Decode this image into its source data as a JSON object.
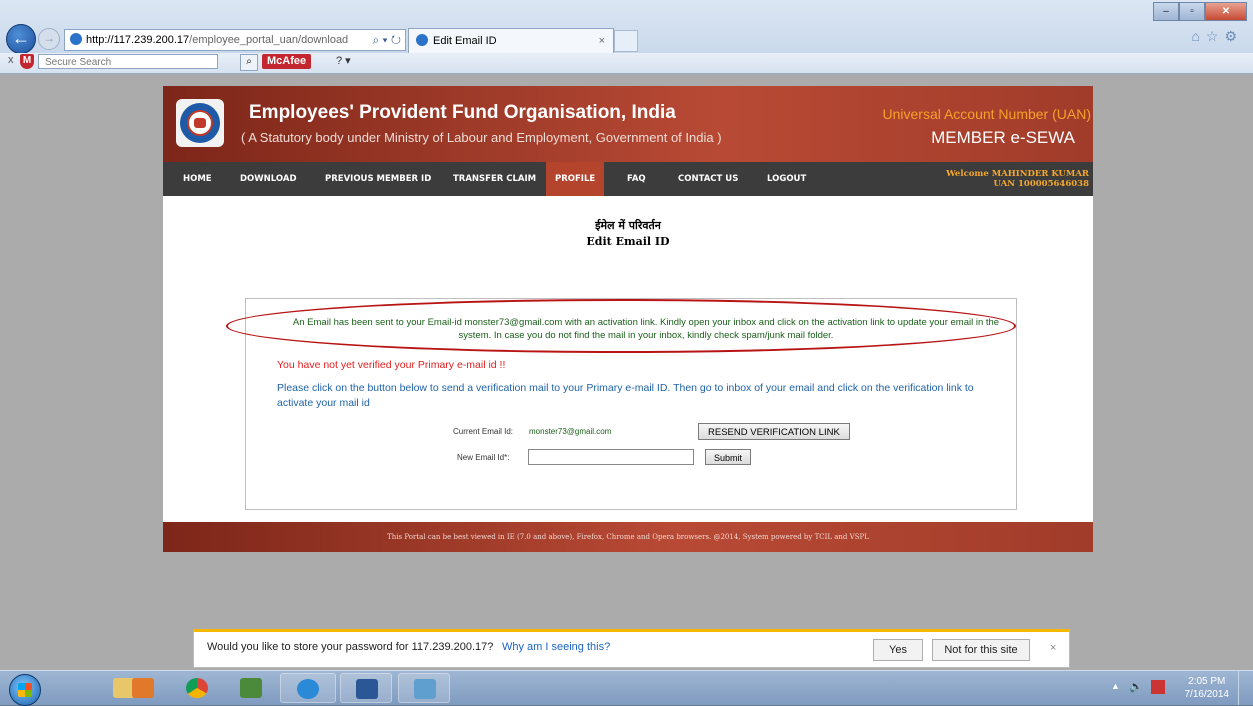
{
  "browser": {
    "url_host": "http://117.239.200.17",
    "url_path": "/employee_portal_uan/download",
    "tab_title": "Edit Email ID",
    "tab_close": "×",
    "search_placeholder": "Secure Search",
    "mcafee_label": "McAfee"
  },
  "site": {
    "org_name": "Employees' Provident Fund Organisation, India",
    "org_sub": "( A Statutory body under Ministry of Labour and Employment, Government of India )",
    "uan_title": "Universal Account Number (UAN)",
    "uan_member": "MEMBER  e-SEWA"
  },
  "nav": {
    "items": [
      "HOME",
      "DOWNLOAD",
      "PREVIOUS MEMBER ID",
      "TRANSFER CLAIM",
      "PROFILE",
      "FAQ",
      "CONTACT US",
      "LOGOUT"
    ],
    "active": "PROFILE",
    "welcome_line": "Welcome MAHINDER KUMAR",
    "uan_line": "UAN  100005646038"
  },
  "page": {
    "title_hindi": "ईमेल में परिवर्तन",
    "title": "Edit Email ID",
    "notice": "An Email has been sent to your Email-id monster73@gmail.com with an activation link. Kindly open your inbox and click on the activation link to update your email in the system. In case you do not find the mail in your inbox, kindly check spam/junk mail folder.",
    "warning": "You have not yet verified your Primary e-mail id !!",
    "instructions": "Please click on the button below to send a verification mail to your Primary e-mail ID. Then go to inbox of your email and click on the verification link to activate your mail id",
    "current_email_label": "Current Email Id:",
    "current_email_value": "monster73@gmail.com",
    "resend_button": "RESEND VERIFICATION LINK",
    "new_email_label": "New Email Id*:",
    "new_email_value": "",
    "submit_button": "Submit"
  },
  "footer": {
    "text": "This Portal can be best viewed in IE (7.0 and above), Firefox, Chrome and Opera browsers.     @2014, System powered by TCIL and VSPL"
  },
  "password_bar": {
    "question": "Would you like to store your password for 117.239.200.17?",
    "why_link": "Why am I seeing this?",
    "yes": "Yes",
    "not_for_site": "Not for this site",
    "close": "×"
  },
  "taskbar": {
    "time": "2:05 PM",
    "date": "7/16/2014"
  },
  "colors": {
    "brand_red": "#b84a35",
    "nav_dark": "#3c3c3c",
    "accent_orange": "#f6a12a",
    "notice_green": "#1a5f1a",
    "warning_red": "#e02020",
    "instruction_blue": "#2163a8",
    "annotation_ellipse": "#b81414"
  }
}
